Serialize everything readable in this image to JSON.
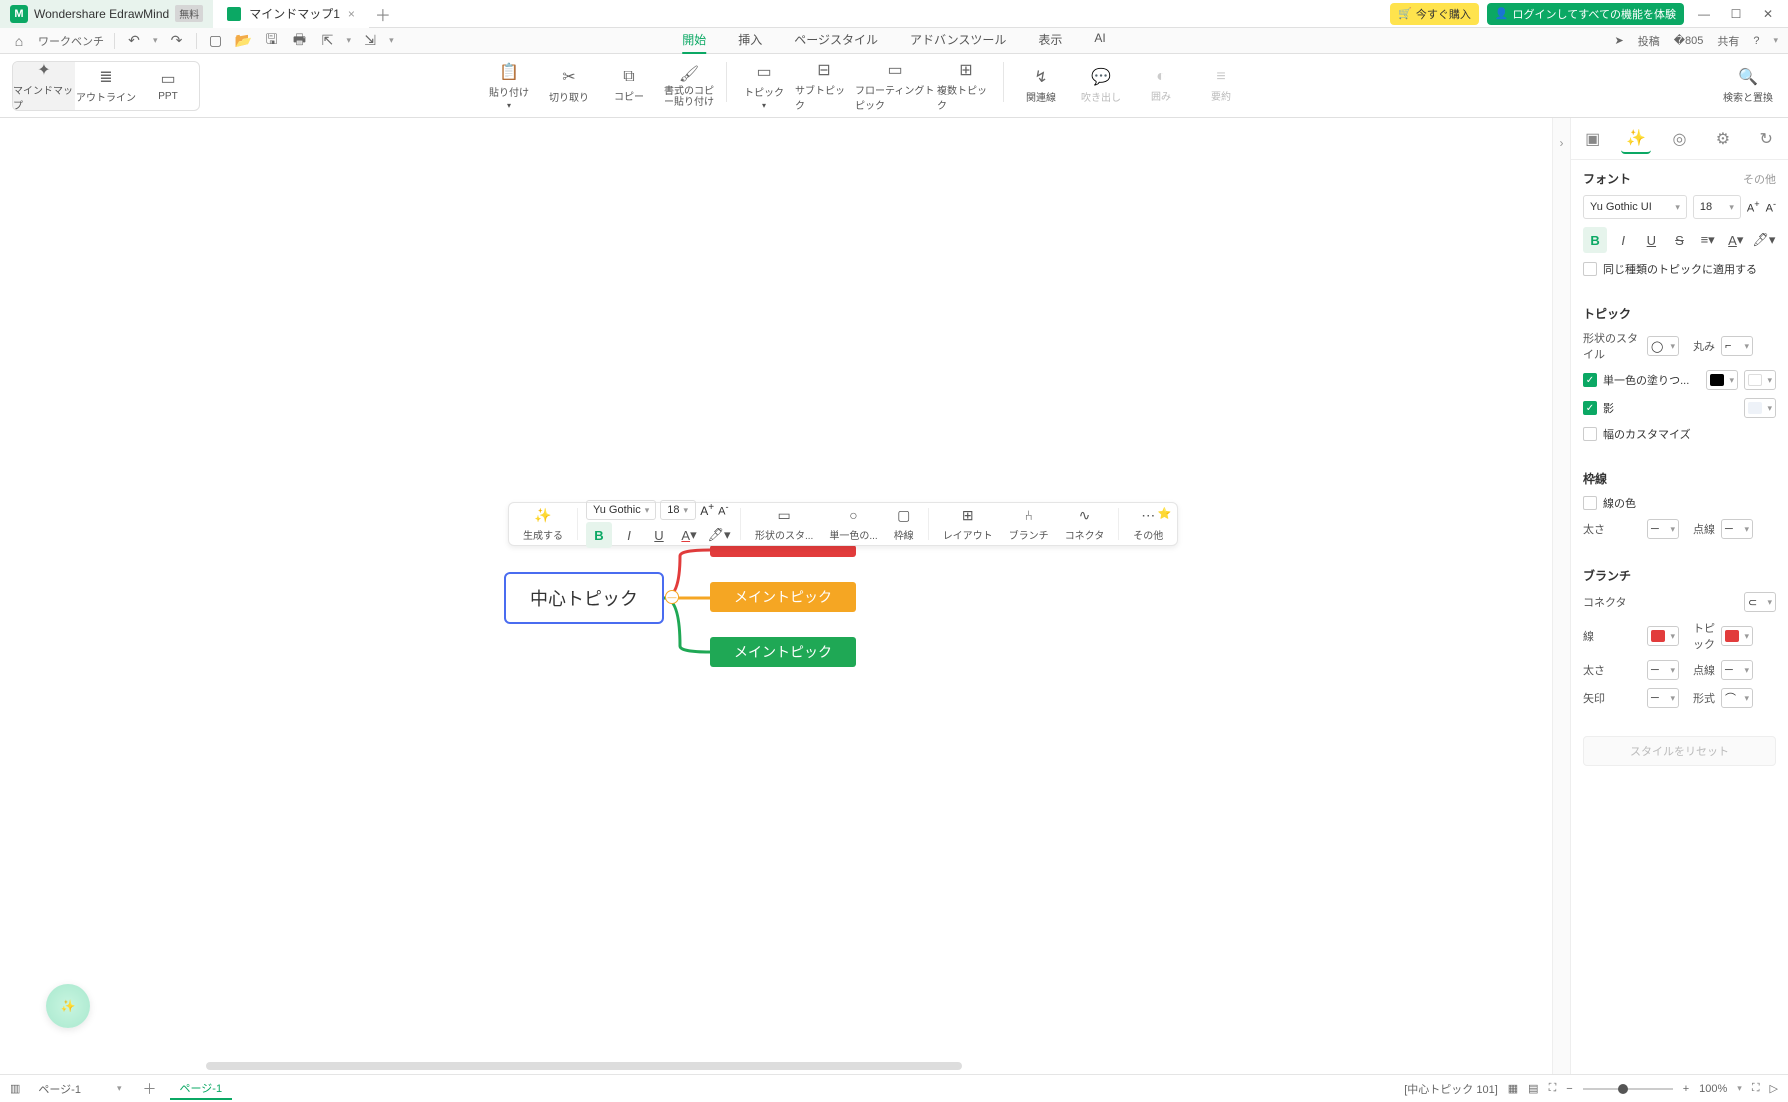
{
  "titlebar": {
    "app_name": "Wondershare EdrawMind",
    "free_badge": "無料",
    "doc_title": "マインドマップ1",
    "buy": "今すぐ購入",
    "login": "ログインしてすべての機能を体験"
  },
  "quickbar": {
    "workbench": "ワークベンチ",
    "post": "投稿",
    "share": "共有",
    "menus": [
      "開始",
      "挿入",
      "ページスタイル",
      "アドバンスツール",
      "表示",
      "AI"
    ],
    "active_menu": "開始"
  },
  "viewmodes": {
    "mindmap": "マインドマップ",
    "outline": "アウトライン",
    "ppt": "PPT"
  },
  "ribbon": {
    "paste": "貼り付け",
    "cut": "切り取り",
    "copy": "コピー",
    "format_paste": "書式のコピー貼り付け",
    "topic": "トピック",
    "subtopic": "サブトピック",
    "floating": "フローティングトピック",
    "multi": "複数トピック",
    "relation": "関連線",
    "callout": "吹き出し",
    "boundary": "囲み",
    "summary": "要約",
    "search": "検索と置換"
  },
  "canvas": {
    "center": "中心トピック",
    "main1": "",
    "main2": "メイントピック",
    "main3": "メイントピック"
  },
  "mini_tb": {
    "generate": "生成する",
    "font": "Yu Gothic",
    "size": "18",
    "shape": "形状のスタ...",
    "fill": "単一色の...",
    "border": "枠線",
    "layout": "レイアウト",
    "branch": "ブランチ",
    "connector": "コネクタ",
    "other": "その他"
  },
  "rpanel": {
    "font_section": "フォント",
    "more": "その他",
    "font_family": "Yu Gothic UI",
    "font_size": "18",
    "apply_same": "同じ種類のトピックに適用する",
    "topic_section": "トピック",
    "shape_style": "形状のスタイル",
    "round": "丸み",
    "fill": "単一色の塗りつ...",
    "shadow": "影",
    "width_custom": "幅のカスタマイズ",
    "border_section": "枠線",
    "border_color": "線の色",
    "thickness": "太さ",
    "dotted": "点線",
    "branch_section": "ブランチ",
    "connector": "コネクタ",
    "line": "線",
    "topic_color": "トピック",
    "arrow": "矢印",
    "format": "形式",
    "reset": "スタイルをリセット"
  },
  "bottombar": {
    "page_current": "ページ-1",
    "page_tab": "ページ-1",
    "status": "[中心トピック 101]",
    "zoom": "100%"
  }
}
